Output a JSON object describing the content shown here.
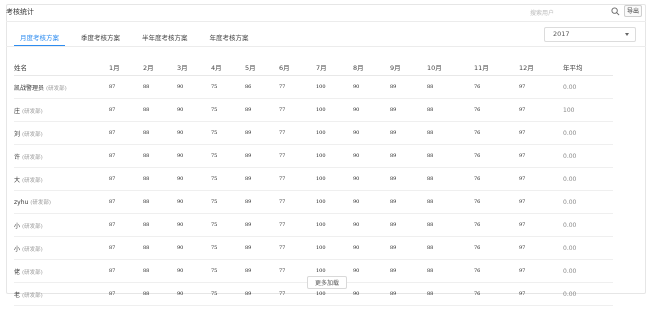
{
  "header": {
    "title": "考核统计",
    "search_placeholder": "搜索用户",
    "export_label": "导出"
  },
  "tabs": [
    {
      "label": "月度考核方案",
      "active": true
    },
    {
      "label": "季度考核方案",
      "active": false
    },
    {
      "label": "半年度考核方案",
      "active": false
    },
    {
      "label": "年度考核方案",
      "active": false
    }
  ],
  "year_select": {
    "value": "2017"
  },
  "table": {
    "columns": [
      "姓名",
      "1月",
      "2月",
      "3月",
      "4月",
      "5月",
      "6月",
      "7月",
      "8月",
      "9月",
      "10月",
      "11月",
      "12月",
      "年平均"
    ],
    "rows": [
      {
        "name": "凯战警理员",
        "dept": "(研发部)",
        "values": [
          "87",
          "88",
          "90",
          "75",
          "86",
          "77",
          "100",
          "90",
          "89",
          "88",
          "76",
          "97"
        ],
        "avg": "0.00"
      },
      {
        "name": "庄",
        "dept": "(研发部)",
        "values": [
          "87",
          "88",
          "90",
          "75",
          "89",
          "77",
          "100",
          "90",
          "89",
          "88",
          "76",
          "97"
        ],
        "avg": "100"
      },
      {
        "name": "刘",
        "dept": "(研发部)",
        "values": [
          "87",
          "88",
          "90",
          "75",
          "89",
          "77",
          "100",
          "90",
          "89",
          "88",
          "76",
          "97"
        ],
        "avg": "0.00"
      },
      {
        "name": "许",
        "dept": "(研发部)",
        "values": [
          "87",
          "88",
          "90",
          "75",
          "89",
          "77",
          "100",
          "90",
          "89",
          "88",
          "76",
          "97"
        ],
        "avg": "0.00"
      },
      {
        "name": "大",
        "dept": "(研发部)",
        "values": [
          "87",
          "88",
          "90",
          "75",
          "89",
          "77",
          "100",
          "90",
          "89",
          "88",
          "76",
          "97"
        ],
        "avg": "0.00"
      },
      {
        "name": "zyhu",
        "dept": "(研发部)",
        "values": [
          "87",
          "88",
          "90",
          "75",
          "89",
          "77",
          "100",
          "90",
          "89",
          "88",
          "76",
          "97"
        ],
        "avg": "0.00"
      },
      {
        "name": "小",
        "dept": "(研发部)",
        "values": [
          "87",
          "88",
          "90",
          "75",
          "89",
          "77",
          "100",
          "90",
          "89",
          "88",
          "76",
          "97"
        ],
        "avg": "0.00"
      },
      {
        "name": "小",
        "dept": "(研发部)",
        "values": [
          "87",
          "88",
          "90",
          "75",
          "89",
          "77",
          "100",
          "90",
          "89",
          "88",
          "76",
          "97"
        ],
        "avg": "0.00"
      },
      {
        "name": "佬",
        "dept": "(研发部)",
        "values": [
          "87",
          "88",
          "90",
          "75",
          "89",
          "77",
          "100",
          "90",
          "89",
          "88",
          "76",
          "97"
        ],
        "avg": "0.00"
      },
      {
        "name": "老",
        "dept": "(研发部)",
        "values": [
          "87",
          "88",
          "90",
          "75",
          "89",
          "77",
          "100",
          "90",
          "89",
          "88",
          "76",
          "97"
        ],
        "avg": "0.00"
      }
    ]
  },
  "load_more_label": "更多加载",
  "colors": {
    "accent": "#2d8cf0",
    "border": "#e6e6e6"
  },
  "icons": {
    "search": "search-icon",
    "dropdown": "chevron-down-icon"
  }
}
